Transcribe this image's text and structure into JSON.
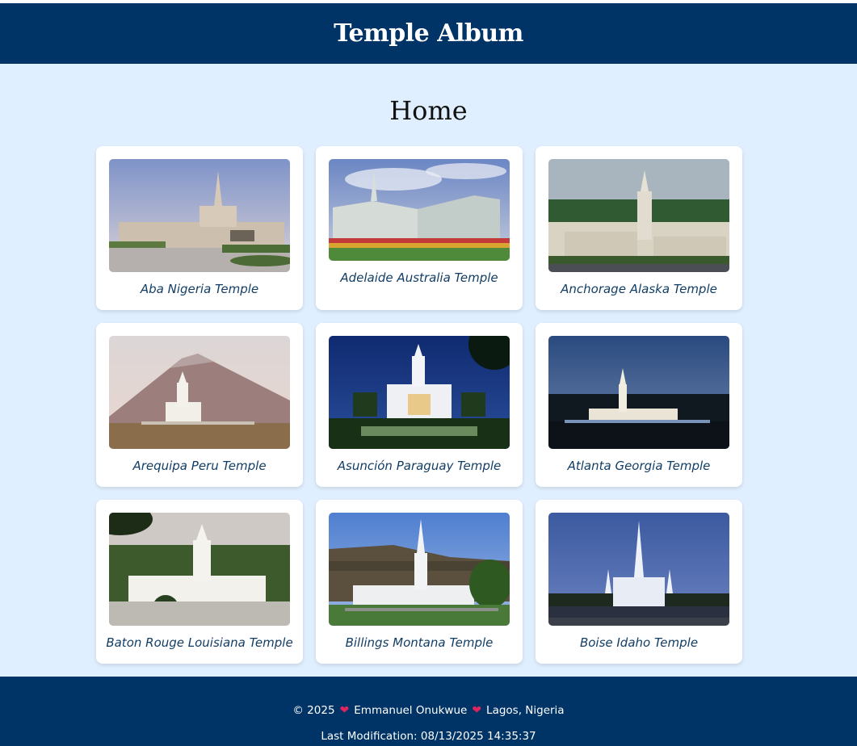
{
  "site": {
    "title": "Temple Album"
  },
  "page": {
    "heading": "Home"
  },
  "temples": [
    {
      "name": "Aba Nigeria Temple"
    },
    {
      "name": "Adelaide Australia Temple"
    },
    {
      "name": "Anchorage Alaska Temple"
    },
    {
      "name": "Arequipa Peru Temple"
    },
    {
      "name": "Asunción Paraguay Temple"
    },
    {
      "name": "Atlanta Georgia Temple"
    },
    {
      "name": "Baton Rouge Louisiana Temple"
    },
    {
      "name": "Billings Montana Temple"
    },
    {
      "name": "Boise Idaho Temple"
    }
  ],
  "footer": {
    "copyright": "© 2025",
    "author": "Emmanuel Onukwue",
    "location": "Lagos, Nigeria",
    "heart_icon": "heart-icon",
    "last_modified": "Last Modification: 08/13/2025 14:35:37"
  },
  "colors": {
    "header_bg": "#003366",
    "page_bg": "#e0efff",
    "caption": "#123e66"
  }
}
